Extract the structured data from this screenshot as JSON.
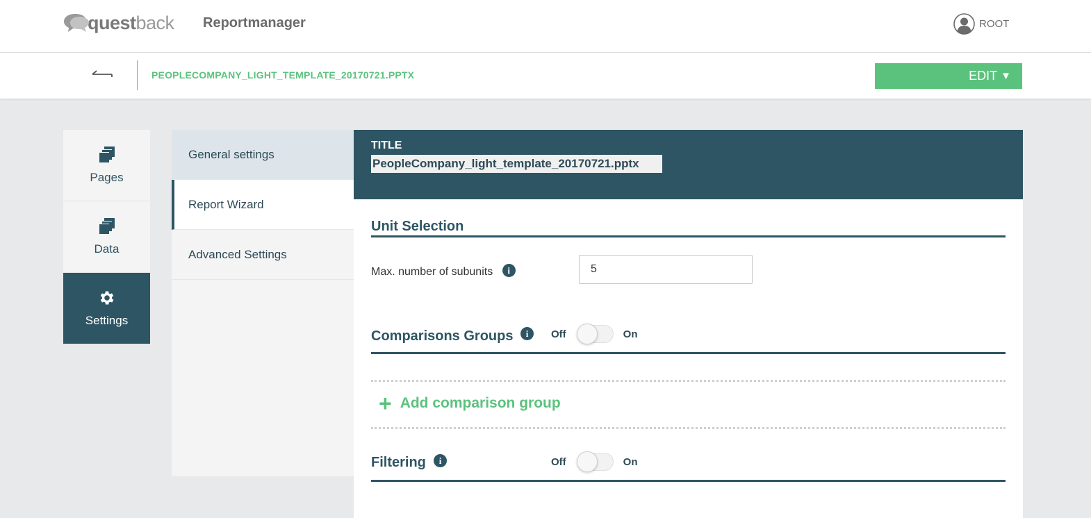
{
  "header": {
    "logo_bold": "quest",
    "logo_light": "back",
    "app_name": "Reportmanager",
    "user": "ROOT"
  },
  "subbar": {
    "file_title": "PEOPLECOMPANY_LIGHT_TEMPLATE_20170721.PPTX",
    "edit_label": "EDIT"
  },
  "left_nav": {
    "items": [
      {
        "label": "Pages",
        "icon": "pages-stack-icon"
      },
      {
        "label": "Data",
        "icon": "data-stack-icon"
      },
      {
        "label": "Settings",
        "icon": "gear-icon",
        "active": true
      }
    ]
  },
  "sub_nav": {
    "items": [
      {
        "label": "General settings"
      },
      {
        "label": "Report Wizard",
        "selected": true
      },
      {
        "label": "Advanced Settings"
      }
    ]
  },
  "main": {
    "title_label": "TITLE",
    "title_value": "PeopleCompany_light_template_20170721.pptx",
    "unit_selection": {
      "heading": "Unit Selection",
      "max_subunits_label": "Max. number of subunits",
      "max_subunits_value": "5"
    },
    "comparison_groups": {
      "heading": "Comparisons Groups",
      "off": "Off",
      "on": "On",
      "add_label": "Add comparison group"
    },
    "filtering": {
      "heading": "Filtering",
      "off": "Off",
      "on": "On"
    },
    "info_glyph": "i"
  },
  "colors": {
    "accent_green": "#5bc27d",
    "primary_teal": "#2e5564"
  }
}
